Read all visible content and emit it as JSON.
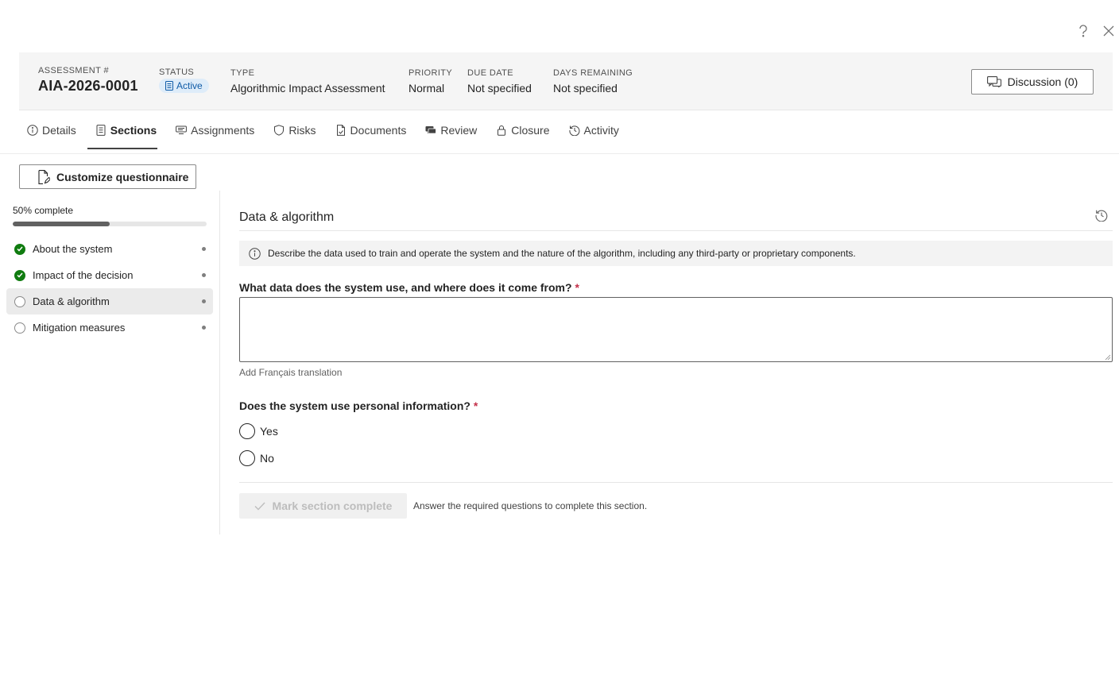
{
  "window": {
    "help_icon": "question-icon",
    "close_icon": "close-icon"
  },
  "header": {
    "assessment_label": "ASSESSMENT #",
    "assessment_value": "AIA-2026-0001",
    "status_label": "STATUS",
    "status_value": "Active",
    "type_label": "TYPE",
    "type_value": "Algorithmic Impact Assessment",
    "priority_label": "PRIORITY",
    "priority_value": "Normal",
    "due_label": "DUE DATE",
    "due_value": "Not specified",
    "days_label": "DAYS REMAINING",
    "days_value": "Not specified",
    "discussion_label": "Discussion (0)"
  },
  "tabs": [
    {
      "label": "Details",
      "icon": "info-icon"
    },
    {
      "label": "Sections",
      "icon": "document-list-icon"
    },
    {
      "label": "Assignments",
      "icon": "people-list-icon"
    },
    {
      "label": "Risks",
      "icon": "shield-icon"
    },
    {
      "label": "Documents",
      "icon": "document-icon"
    },
    {
      "label": "Review",
      "icon": "chat-icon"
    },
    {
      "label": "Closure",
      "icon": "lock-icon"
    },
    {
      "label": "Activity",
      "icon": "history-icon"
    }
  ],
  "active_tab": "Sections",
  "toolbar": {
    "customize_label": "Customize questionnaire"
  },
  "progress": {
    "label": "50% complete",
    "fraction": 0.5
  },
  "sections": [
    {
      "label": "About the system",
      "state": "done"
    },
    {
      "label": "Impact of the decision",
      "state": "done"
    },
    {
      "label": "Data & algorithm",
      "state": "todo"
    },
    {
      "label": "Mitigation measures",
      "state": "todo"
    }
  ],
  "active_section": "Data & algorithm",
  "content": {
    "title": "Data & algorithm",
    "info_text": "Describe the data used to train and operate the system and the nature of the algorithm, including any third-party or proprietary components.",
    "q1_label": "What data does the system use, and where does it come from?",
    "q1_required": "*",
    "q1_value": "",
    "add_translation": "Add Français translation",
    "q2_label": "Does the system use personal information?",
    "q2_required": "*",
    "q2_options": [
      "Yes",
      "No"
    ],
    "mark_complete_label": "Mark section complete",
    "footer_note": "Answer the required questions to complete this section."
  },
  "colors": {
    "accent": "#0f5ba7",
    "done": "#107c10",
    "required": "#c4314b"
  }
}
